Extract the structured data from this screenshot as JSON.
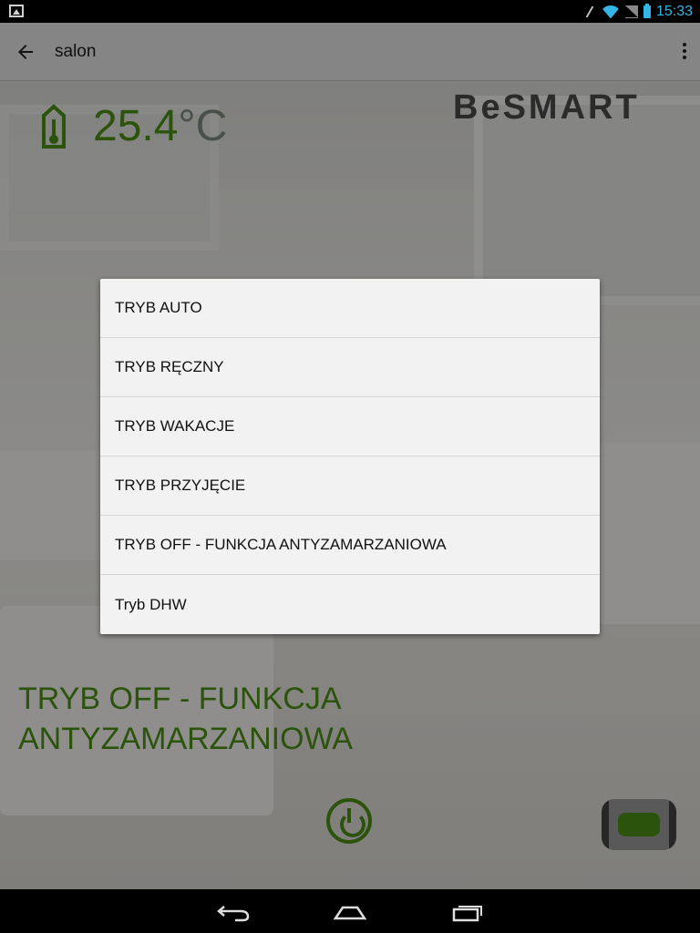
{
  "status_bar": {
    "time": "15:33",
    "icons": [
      "gallery-icon",
      "mute-icon",
      "wifi-icon",
      "signal-icon",
      "battery-icon"
    ]
  },
  "action_bar": {
    "title": "salon",
    "back_icon": "back-arrow-icon",
    "overflow_icon": "overflow-menu-icon"
  },
  "thermostat": {
    "temperature": "25.4",
    "unit": "°C",
    "icon": "thermometer-house-icon"
  },
  "brand": {
    "logo_text": "BeSMART"
  },
  "current_mode": {
    "label": "TRYB OFF - FUNKCJA ANTYZAMARZANIOWA"
  },
  "popup_menu": {
    "items": [
      {
        "label": "TRYB AUTO"
      },
      {
        "label": "TRYB RĘCZNY"
      },
      {
        "label": "TRYB WAKACJE"
      },
      {
        "label": "TRYB PRZYJĘCIE"
      },
      {
        "label": "TRYB OFF - FUNKCJA ANTYZAMARZANIOWA"
      },
      {
        "label": "Tryb DHW"
      }
    ]
  },
  "controls": {
    "power_icon": "power-icon",
    "toggle_icon": "mode-toggle-switch"
  },
  "nav_bar": {
    "buttons": [
      "back-nav-icon",
      "home-nav-icon",
      "recents-nav-icon"
    ]
  },
  "colors": {
    "accent_green": "#4a8f16",
    "clock_blue": "#33b5e5"
  }
}
